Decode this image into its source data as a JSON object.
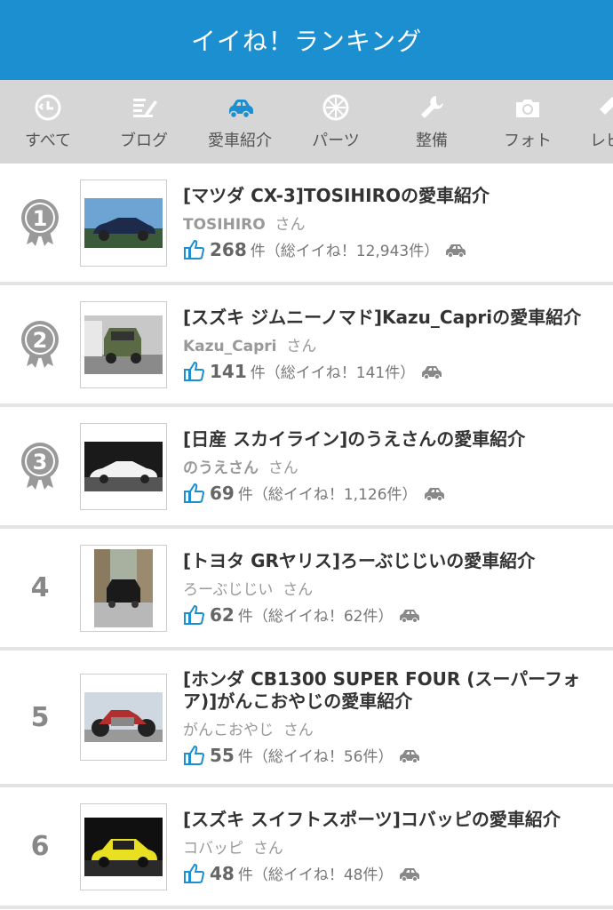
{
  "header": {
    "title": "イイね！ランキング"
  },
  "tabs": [
    {
      "label": "すべて",
      "icon": "all-icon"
    },
    {
      "label": "ブログ",
      "icon": "blog-icon"
    },
    {
      "label": "愛車紹介",
      "icon": "car-icon"
    },
    {
      "label": "パーツ",
      "icon": "parts-icon"
    },
    {
      "label": "整備",
      "icon": "wrench-icon"
    },
    {
      "label": "フォト",
      "icon": "camera-icon"
    },
    {
      "label": "レビ",
      "icon": "review-icon"
    }
  ],
  "entries": [
    {
      "rank": "1",
      "title": "[マツダ CX-3]TOSIHIROの愛車紹介",
      "author": "TOSIHIRO",
      "san": "さん",
      "count": "268",
      "ken": "件",
      "total": "（総イイね！12,943件）"
    },
    {
      "rank": "2",
      "title": "[スズキ ジムニーノマド]Kazu_Capriの愛車紹介",
      "author": "Kazu_Capri",
      "san": "さん",
      "count": "141",
      "ken": "件",
      "total": "（総イイね！141件）"
    },
    {
      "rank": "3",
      "title": "[日産 スカイライン]のうえさんの愛車紹介",
      "author": "のうえさん",
      "san": "さん",
      "count": "69",
      "ken": "件",
      "total": "（総イイね！1,126件）"
    },
    {
      "rank": "4",
      "title": "[トヨタ GRヤリス]ろーぶじじいの愛車紹介",
      "author": "ろーぶじじい",
      "san": "さん",
      "count": "62",
      "ken": "件",
      "total": "（総イイね！62件）"
    },
    {
      "rank": "5",
      "title": "[ホンダ CB1300 SUPER FOUR (スーパーフォア)]がんこおやじの愛車紹介",
      "author": "がんこおやじ",
      "san": "さん",
      "count": "55",
      "ken": "件",
      "total": "（総イイね！56件）"
    },
    {
      "rank": "6",
      "title": "[スズキ スイフトスポーツ]コバッピの愛車紹介",
      "author": "コバッピ",
      "san": "さん",
      "count": "48",
      "ken": "件",
      "total": "（総イイね！48件）"
    }
  ],
  "colors": {
    "header": "#1b8fd0",
    "tabs_bg": "#d6d6d6",
    "like_blue": "#1b8fd0",
    "active_tab_icon": "#1b8fd0",
    "medal": "#999999"
  }
}
